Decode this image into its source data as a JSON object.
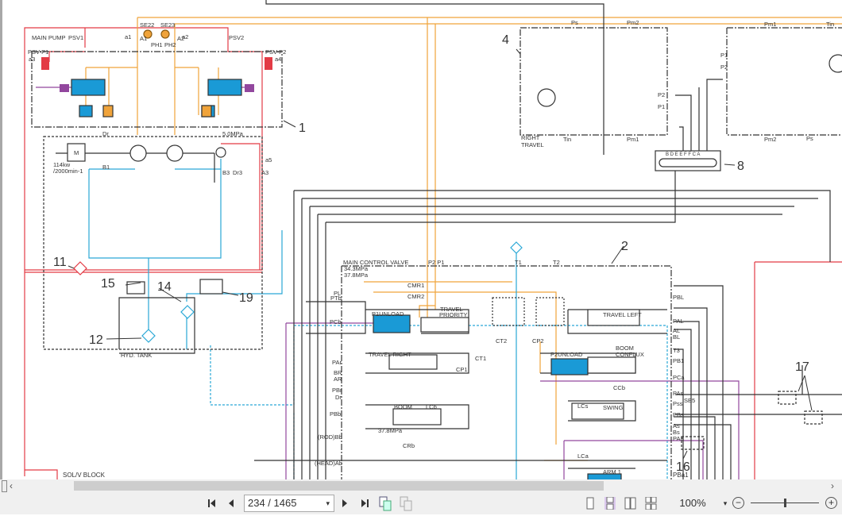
{
  "schematic": {
    "labels": {
      "main_pump": "MAIN PUMP",
      "psv1": "PSV1",
      "psv2": "PSV2",
      "psv_p1": "PSV-P1",
      "psv_p2": "PSV-P2",
      "a1": "a1",
      "a2": "a2",
      "a3": "a3",
      "a4": "a4",
      "a5": "a5",
      "A1": "A1",
      "A2": "A2",
      "A3": "A3",
      "se22": "SE22",
      "se23": "SE23",
      "ph1": "PH1",
      "ph2": "PH2",
      "dr": "Dr",
      "b1": "B1",
      "b3": "B3",
      "dr3": "Dr3",
      "pressure_5": "5.0MPa",
      "motor": "M",
      "power": "114kw",
      "speed": "/2000min-1",
      "hyd_tank": "HYD. TANK",
      "solv_block": "SOL/V BLOCK",
      "mcv": "MAIN CONTROL VALVE",
      "p2p1": "P2 P1",
      "t1": "T1",
      "t2": "T2",
      "t3": "T3",
      "p343": "34.3MPa",
      "p378": "37.8MPa",
      "p378b": "37.8MPa",
      "cmr1": "CMR1",
      "cmr2": "CMR2",
      "pl": "PL",
      "ptb": "PTb",
      "pcb": "PCb",
      "par": "PAr",
      "br": "BR",
      "ar": "AR",
      "pbr": "PBr",
      "drl": "Dr",
      "pbb": "PBb",
      "rodbb": "(ROD)Bb",
      "headab": "(HEAD)Ab",
      "p1unload": "P1UNLOAD",
      "travel": "TRAVEL",
      "priority": "PRIORITY",
      "travel_right": "TRAVEL RIGHT",
      "cp1": "CP1",
      "ct1": "CT1",
      "ct2": "CT2",
      "cp2": "CP2",
      "boom": "BOOM",
      "lcb": "LCb",
      "crb": "CRb",
      "travel_left": "TRAVEL LEFT",
      "p2unload": "P2UNLOAD",
      "boom_conflux": "BOOM",
      "conflux": "CONFLUX",
      "ccb": "CCb",
      "lcs": "LCs",
      "swing": "SWING",
      "lca": "LCa",
      "arm1": "ARM 1",
      "pbl": "PBL",
      "pal": "PAL",
      "al": "AL",
      "bl": "BL",
      "pb1": "PB1",
      "pca": "PCa",
      "pas": "PAs",
      "pss": "Pss",
      "se5": "SE5",
      "pbs": "PBs",
      "as": "As",
      "bs": "Bs",
      "pa1": "PAa",
      "pba1": "PBa1",
      "ps": "Ps",
      "pm2": "Pm2",
      "pm1": "Pm1",
      "tin": "Tin",
      "p1": "P1",
      "p2": "P2",
      "right": "RIGHT",
      "travel_r": "TRAVEL",
      "ps_r": "Ps",
      "pm1_r": "Pm1",
      "pm2_r": "Pm2",
      "tin_r": "Tin",
      "p1_r": "P1",
      "p2_r": "P2",
      "swivel": "B D E E F F C A"
    },
    "callouts": [
      "1",
      "2",
      "4",
      "8",
      "11",
      "12",
      "14",
      "15",
      "16",
      "17",
      "19"
    ],
    "colors": {
      "pilot": "#e33b45",
      "signal": "#f0a33a",
      "drain": "#2aa8d6",
      "solenoid": "#92479e",
      "main": "#333333",
      "spool": "#1a9ad6"
    }
  },
  "scrollbar": {
    "left_arrow": "‹",
    "right_arrow": "›"
  },
  "toolbar": {
    "first_page": "first-page",
    "prev_page": "prev-page",
    "next_page": "next-page",
    "last_page": "last-page",
    "page_value": "234 / 1465",
    "zoom_value": "100%",
    "zoom_dropdown": "▾",
    "zoom_out": "−",
    "zoom_in": "+",
    "view_modes": [
      "single-page",
      "continuous",
      "facing",
      "continuous-facing"
    ],
    "selected_view": "continuous",
    "zoom_level": 0.5
  }
}
